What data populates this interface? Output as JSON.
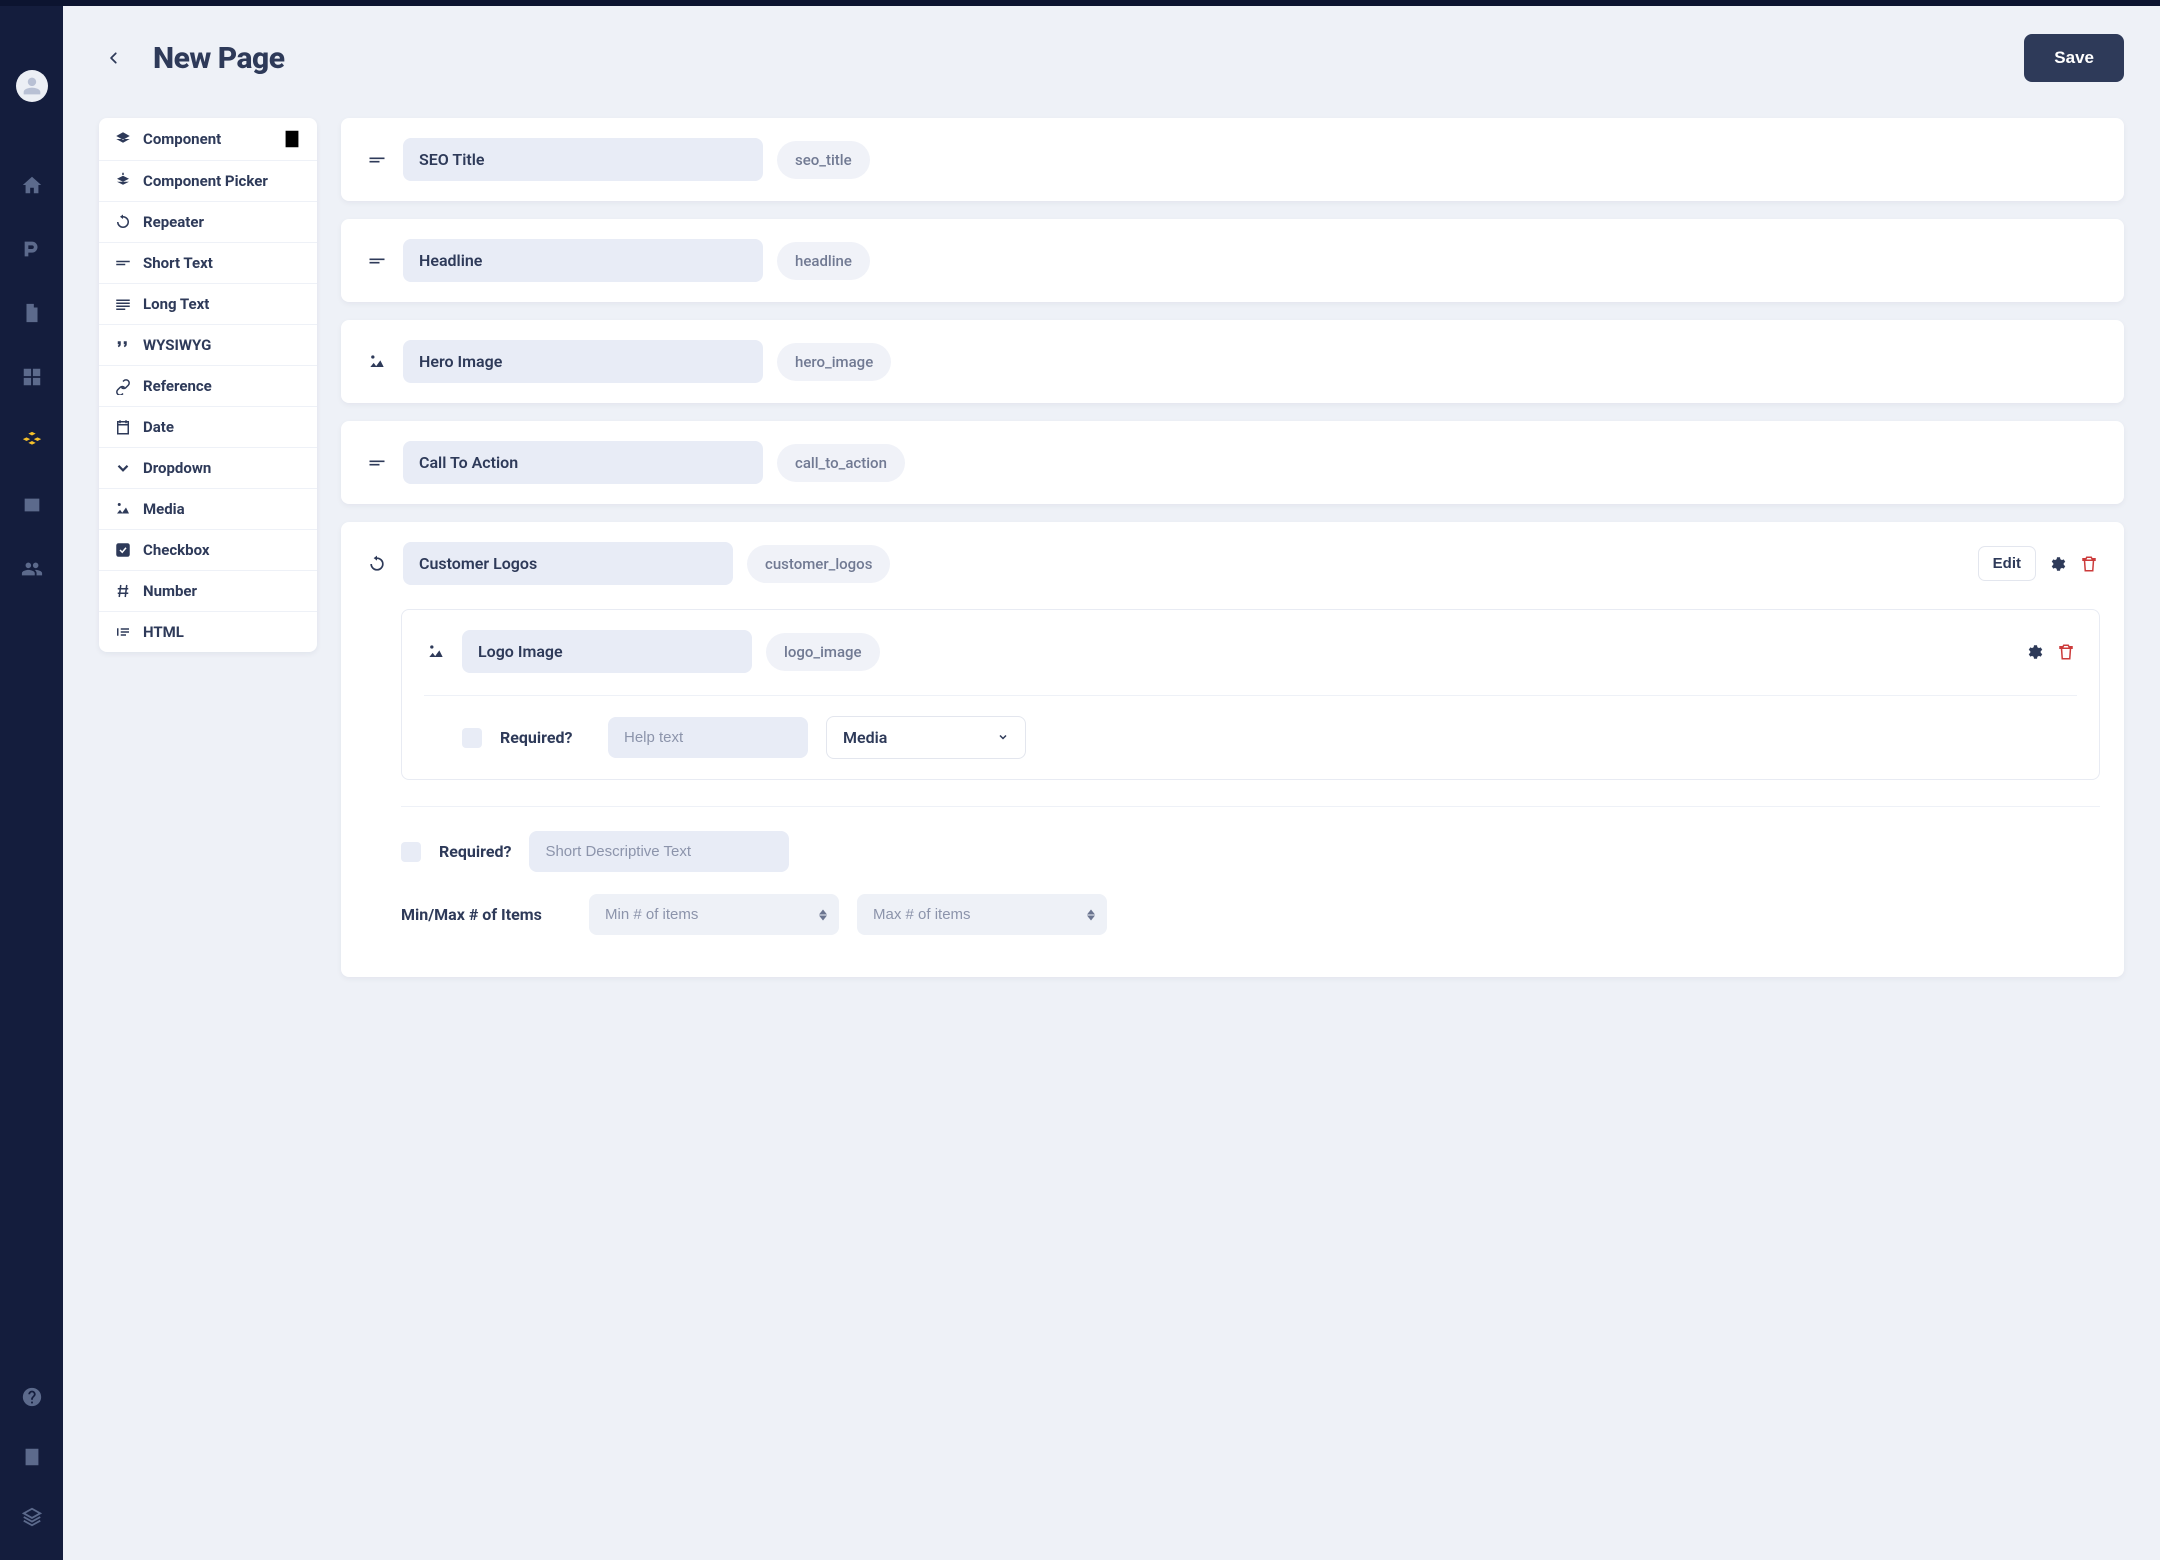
{
  "header": {
    "title": "New Page",
    "save_label": "Save"
  },
  "field_types": [
    {
      "label": "Component",
      "icon": "layers",
      "extra_icon": true
    },
    {
      "label": "Component Picker",
      "icon": "layers-plus"
    },
    {
      "label": "Repeater",
      "icon": "repeat"
    },
    {
      "label": "Short Text",
      "icon": "short-text"
    },
    {
      "label": "Long Text",
      "icon": "long-text"
    },
    {
      "label": "WYSIWYG",
      "icon": "quote"
    },
    {
      "label": "Reference",
      "icon": "link"
    },
    {
      "label": "Date",
      "icon": "calendar"
    },
    {
      "label": "Dropdown",
      "icon": "chevron-down"
    },
    {
      "label": "Media",
      "icon": "media"
    },
    {
      "label": "Checkbox",
      "icon": "checkbox"
    },
    {
      "label": "Number",
      "icon": "hash"
    },
    {
      "label": "HTML",
      "icon": "html"
    }
  ],
  "fields": [
    {
      "icon": "short-text",
      "label": "SEO Title",
      "slug": "seo_title"
    },
    {
      "icon": "short-text",
      "label": "Headline",
      "slug": "headline"
    },
    {
      "icon": "media",
      "label": "Hero Image",
      "slug": "hero_image"
    },
    {
      "icon": "short-text",
      "label": "Call To Action",
      "slug": "call_to_action"
    }
  ],
  "repeater": {
    "icon": "repeat",
    "label": "Customer Logos",
    "slug": "customer_logos",
    "edit_label": "Edit",
    "child": {
      "icon": "media",
      "label": "Logo Image",
      "slug": "logo_image",
      "required_label": "Required?",
      "help_placeholder": "Help text",
      "type_selected": "Media"
    },
    "required_label": "Required?",
    "desc_placeholder": "Short Descriptive Text",
    "minmax_label": "Min/Max # of Items",
    "min_placeholder": "Min # of items",
    "max_placeholder": "Max # of items"
  }
}
